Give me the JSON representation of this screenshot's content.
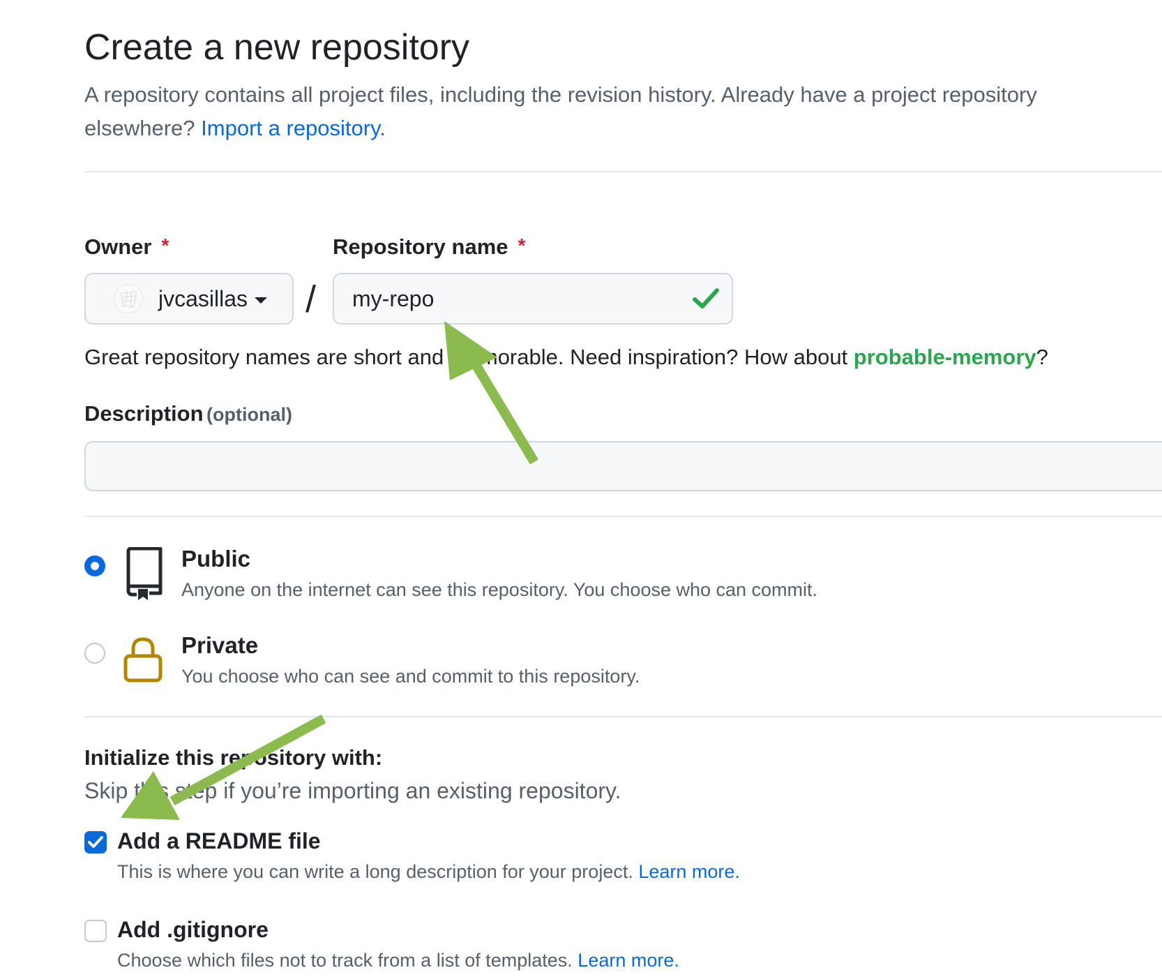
{
  "page": {
    "title": "Create a new repository",
    "subtitle": "A repository contains all project files, including the revision history. Already have a project repository elsewhere?",
    "import_link": "Import a repository."
  },
  "owner": {
    "label": "Owner",
    "required_mark": "*",
    "value": "jvcasillas",
    "icon": "chevron-down-icon"
  },
  "separator": "/",
  "repo_name": {
    "label": "Repository name",
    "required_mark": "*",
    "value": "my-repo",
    "status_icon": "check-icon",
    "status_color": "#2da44e"
  },
  "hint": {
    "text_before": "Great repository names are short and memorable. Need inspiration? How about ",
    "suggestion": "probable-memory",
    "text_after": "?"
  },
  "description": {
    "label": "Description",
    "optional": "(optional)",
    "value": ""
  },
  "visibility": {
    "selected": "public",
    "options": [
      {
        "id": "public",
        "title": "Public",
        "description": "Anyone on the internet can see this repository. You choose who can commit.",
        "icon": "repo-icon"
      },
      {
        "id": "private",
        "title": "Private",
        "description": "You choose who can see and commit to this repository.",
        "icon": "lock-icon"
      }
    ]
  },
  "initialize": {
    "title": "Initialize this repository with:",
    "subtitle": "Skip this step if you’re importing an existing repository.",
    "options": [
      {
        "title": "Add a README file",
        "description": "This is where you can write a long description for your project.",
        "link": "Learn more.",
        "checked": true
      },
      {
        "title": "Add .gitignore",
        "description": "Choose which files not to track from a list of templates.",
        "link": "Learn more.",
        "checked": false
      }
    ]
  },
  "colors": {
    "accent": "#0969da",
    "success": "#2da44e",
    "required": "#cf222e",
    "lock_icon": "#b08800",
    "annotation_arrow": "#8bbb4f"
  }
}
